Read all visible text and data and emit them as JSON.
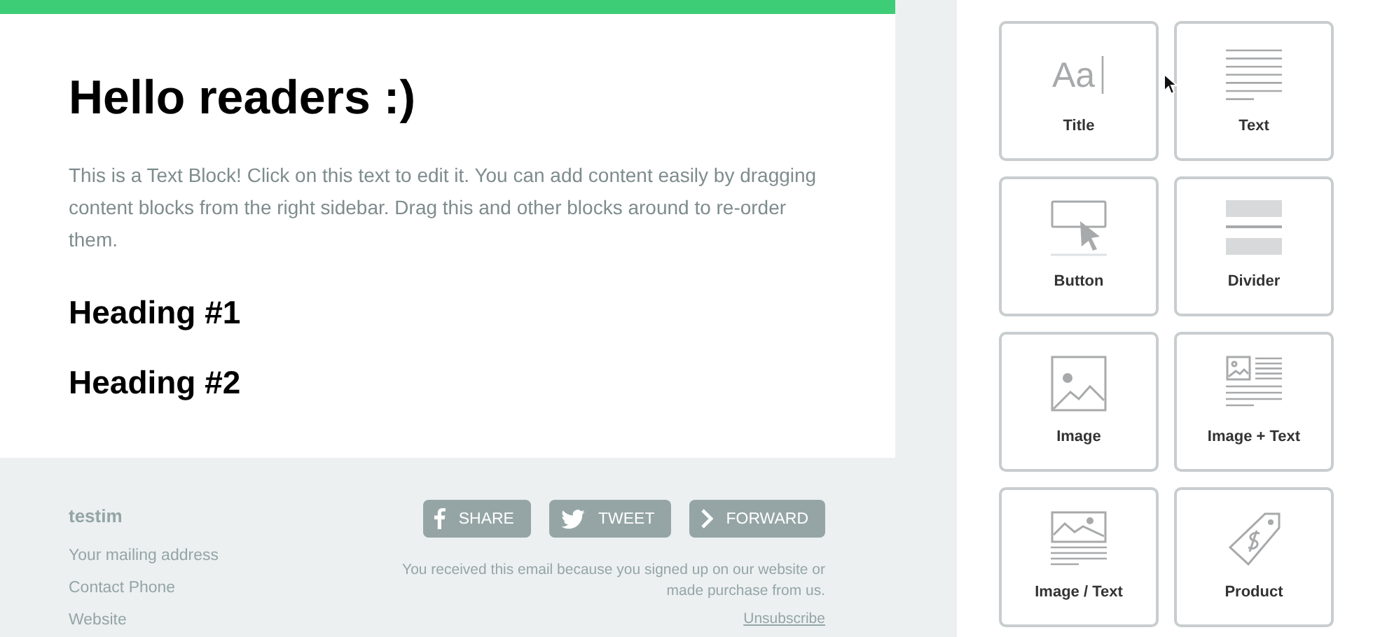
{
  "email": {
    "title": "Hello readers :)",
    "paragraph": "This is a Text Block! Click on this text to edit it. You can add content easily by dragging content blocks from the right sidebar. Drag this and other blocks around to re-order them.",
    "headings": [
      "Heading #1",
      "Heading #2"
    ]
  },
  "footer": {
    "company": "testim",
    "lines": [
      "Your mailing address",
      "Contact Phone",
      "Website"
    ],
    "social_buttons": [
      {
        "kind": "facebook",
        "label": "SHARE"
      },
      {
        "kind": "twitter",
        "label": "TWEET"
      },
      {
        "kind": "forward",
        "label": "FORWARD"
      }
    ],
    "notice": "You received this email because you signed up on our website or made purchase from us.",
    "unsubscribe": "Unsubscribe"
  },
  "blocks": [
    {
      "kind": "title",
      "label": "Title",
      "icon_text": "Aa"
    },
    {
      "kind": "text",
      "label": "Text"
    },
    {
      "kind": "button",
      "label": "Button"
    },
    {
      "kind": "divider",
      "label": "Divider"
    },
    {
      "kind": "image",
      "label": "Image"
    },
    {
      "kind": "image_text",
      "label": "Image + Text"
    },
    {
      "kind": "image_over_text",
      "label": "Image / Text"
    },
    {
      "kind": "product",
      "label": "Product"
    }
  ]
}
